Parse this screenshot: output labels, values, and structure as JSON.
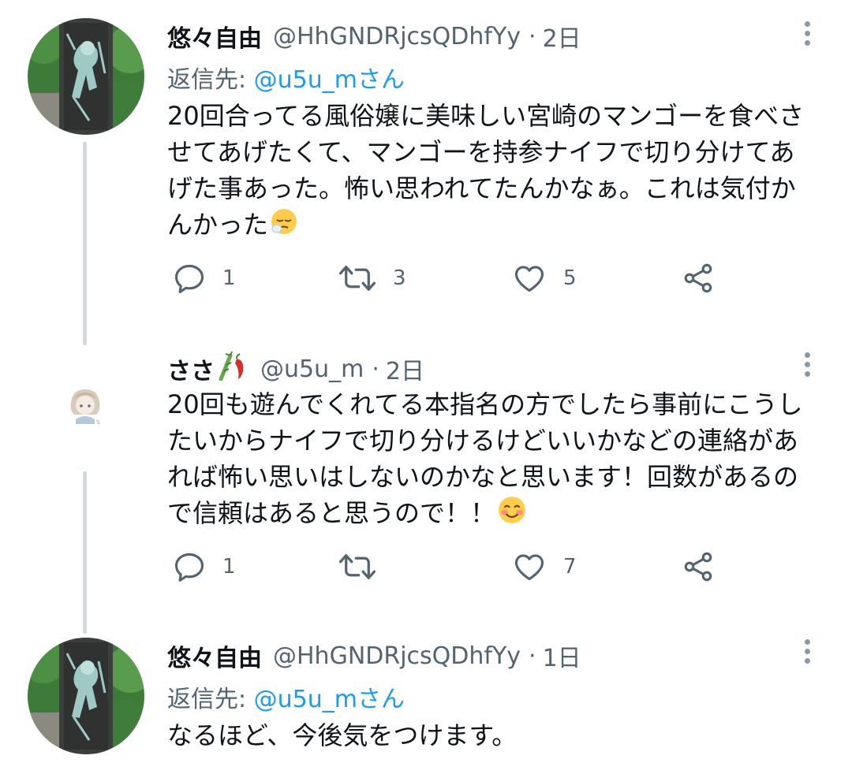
{
  "tweets": [
    {
      "name": "悠々自由",
      "handle": "@HhGNDRjcsQDhfYy",
      "dot": "·",
      "time": "2日",
      "reply_prefix": "返信先: ",
      "reply_mention": "@u5u_mさん",
      "text_lines": [
        "20回合ってる風俗嬢に美味しい宮崎のマンゴーを食べさ",
        "せてあげたくて、マンゴーを持参ナイフで切り分けてあ",
        "げた事あった。怖い思われてたんかなぁ。これは気付か",
        "んかった"
      ],
      "text_emoji": "sleepy-face-emoji",
      "replies": "1",
      "retweets": "3",
      "likes": "5"
    },
    {
      "name": "ささ",
      "name_emoji": "bamboo-pepper-emoji",
      "handle": "@u5u_m",
      "dot": "·",
      "time": "2日",
      "text_lines": [
        "20回も遊んでくれてる本指名の方でしたら事前にこうし",
        "たいからナイフで切り分けるけどいいかなどの連絡があ",
        "れば怖い思いはしないのかなと思います！回数があるの",
        "で信頼はあると思うので！！"
      ],
      "text_emoji": "smiling-face-emoji",
      "replies": "1",
      "retweets": "",
      "likes": "7"
    },
    {
      "name": "悠々自由",
      "handle": "@HhGNDRjcsQDhfYy",
      "dot": "·",
      "time": "1日",
      "reply_prefix": "返信先: ",
      "reply_mention": "@u5u_mさん",
      "text_lines": [
        "なるほど、今後気をつけます。"
      ]
    }
  ],
  "colors": {
    "text": "#0f1419",
    "secondary": "#536471",
    "link": "#1d9bf0",
    "thread_line": "#cfd9de"
  },
  "icons": [
    "reply-icon",
    "retweet-icon",
    "like-icon",
    "share-icon",
    "more-icon"
  ]
}
